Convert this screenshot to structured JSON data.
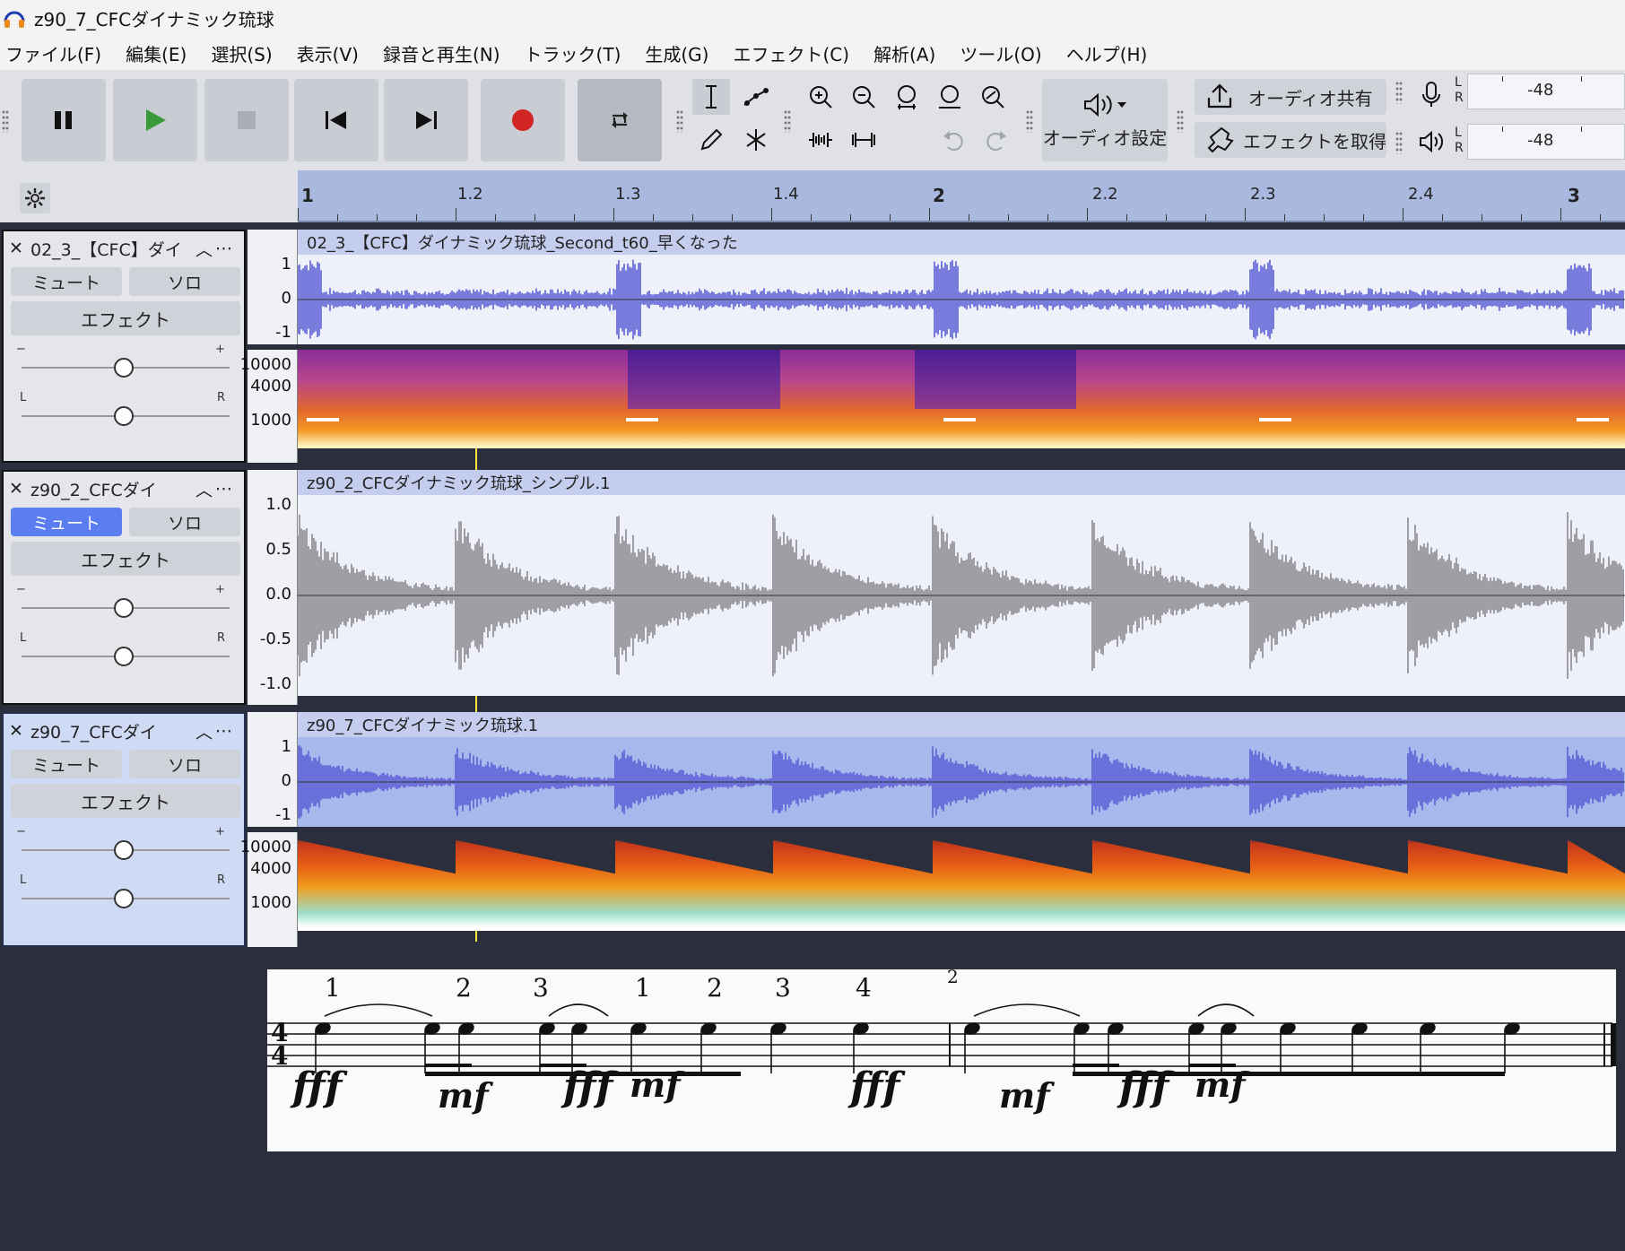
{
  "window": {
    "title": "z90_7_CFCダイナミック琉球"
  },
  "menu": [
    "ファイル(F)",
    "編集(E)",
    "選択(S)",
    "表示(V)",
    "録音と再生(N)",
    "トラック(T)",
    "生成(G)",
    "エフェクト(C)",
    "解析(A)",
    "ツール(O)",
    "ヘルプ(H)"
  ],
  "toolbar": {
    "transport_icons": [
      "pause-icon",
      "play-icon",
      "stop-icon",
      "skip-start-icon",
      "skip-end-icon",
      "record-icon",
      "loop-icon"
    ],
    "audio_setup_label": "オーディオ設定",
    "share_audio_label": "オーディオ共有",
    "get_effects_label": "エフェクトを取得",
    "record_meter": {
      "l": "L",
      "r": "R",
      "value": "-48"
    },
    "playback_meter": {
      "l": "L",
      "r": "R",
      "value": "-48"
    }
  },
  "timeline": {
    "labels": [
      "1",
      "1.2",
      "1.3",
      "1.4",
      "2",
      "2.2",
      "2.3",
      "2.4",
      "3"
    ]
  },
  "tracks": [
    {
      "name": "02_3_【CFC】ダイ",
      "mute_label": "ミュート",
      "solo_label": "ソロ",
      "effects_label": "エフェクト",
      "muted": false,
      "gain_minus": "−",
      "gain_plus": "+",
      "pan_left": "L",
      "pan_right": "R",
      "clip_name": "02_3_【CFC】ダイナミック琉球_Second_t60_早くなった",
      "wave_scale": [
        "1",
        "0",
        "-1"
      ],
      "spec_scale": [
        "10000",
        "4000",
        "1000"
      ],
      "view": "multi",
      "wave_color": "#5b5fd6"
    },
    {
      "name": "z90_2_CFCダイ",
      "mute_label": "ミュート",
      "solo_label": "ソロ",
      "effects_label": "エフェクト",
      "muted": true,
      "gain_minus": "−",
      "gain_plus": "+",
      "pan_left": "L",
      "pan_right": "R",
      "clip_name": "z90_2_CFCダイナミック琉球_シンプル.1",
      "wave_scale": [
        "1.0",
        "0.5",
        "0.0",
        "-0.5",
        "-1.0"
      ],
      "view": "waveform",
      "wave_color": "#8a8a8e"
    },
    {
      "name": "z90_7_CFCダイ",
      "mute_label": "ミュート",
      "solo_label": "ソロ",
      "effects_label": "エフェクト",
      "muted": false,
      "selected": true,
      "gain_minus": "−",
      "gain_plus": "+",
      "pan_left": "L",
      "pan_right": "R",
      "clip_name": "z90_7_CFCダイナミック琉球.1",
      "wave_scale": [
        "1",
        "0",
        "-1"
      ],
      "spec_scale": [
        "10000",
        "4000",
        "1000"
      ],
      "view": "multi",
      "wave_color": "#5b5fd6"
    }
  ],
  "notation": {
    "time_signature": "4/4",
    "beat_numbers": [
      "1",
      "2",
      "3",
      "1",
      "2",
      "3",
      "4"
    ],
    "measure_number": "2",
    "dynamics": [
      "fff",
      "mf",
      "fff",
      "mf",
      "fff",
      "mf",
      "fff",
      "mf"
    ]
  }
}
